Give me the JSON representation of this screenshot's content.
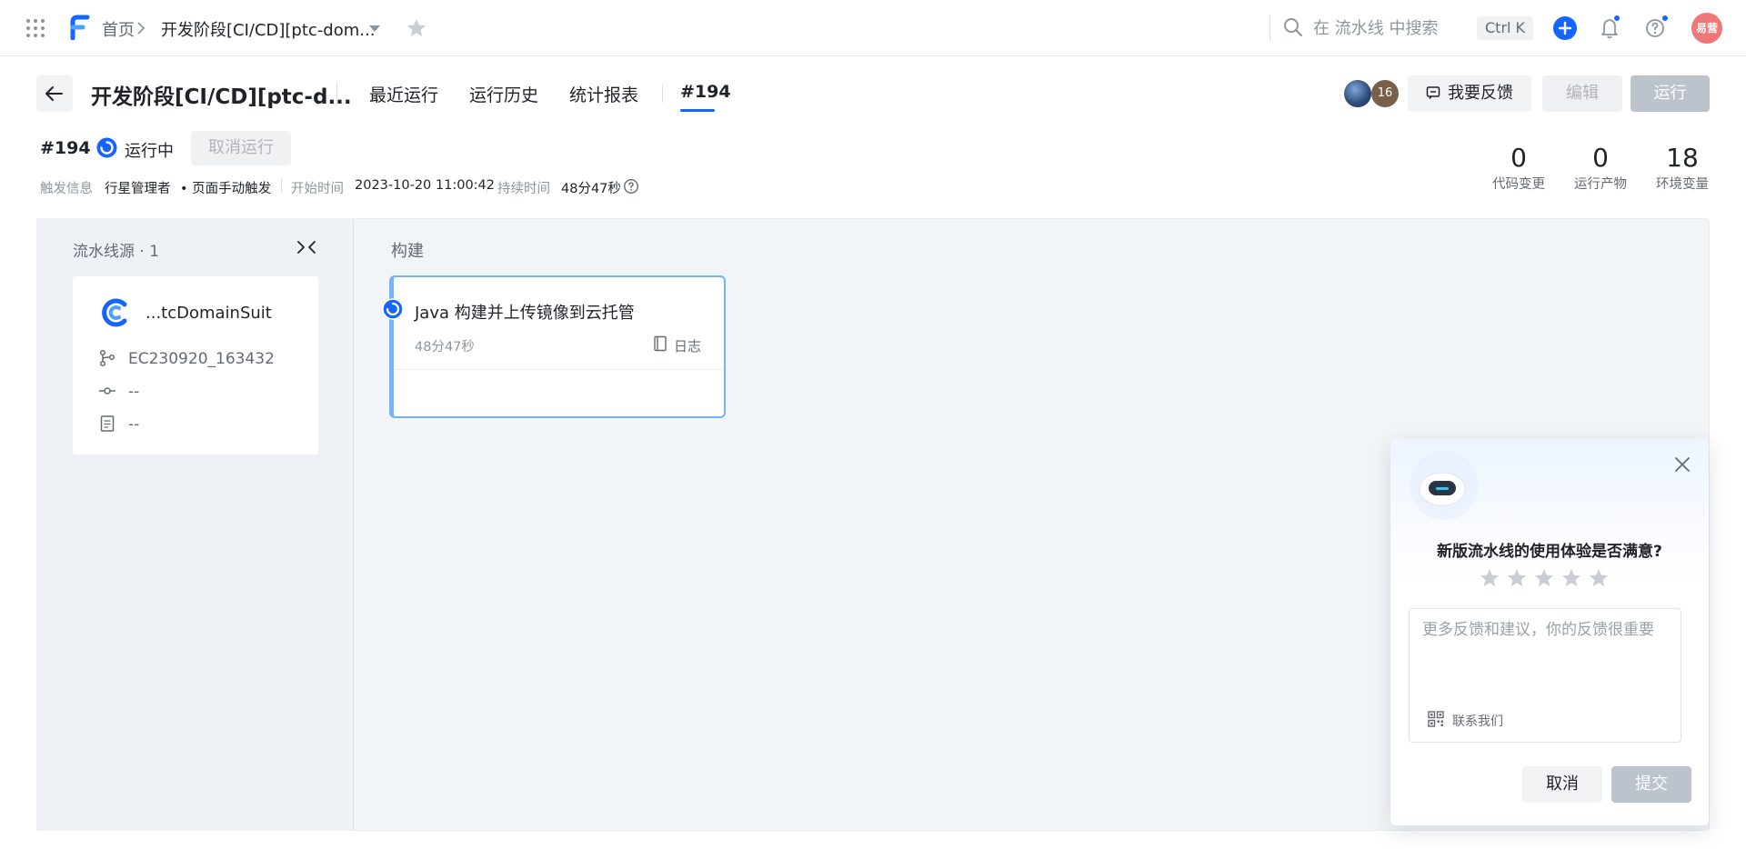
{
  "topbar": {
    "home": "首页",
    "current": "开发阶段[CI/CD][ptc-dom...",
    "search_placeholder": "在 流水线 中搜索",
    "shortcut": "Ctrl K",
    "avatar_text": "易营"
  },
  "header": {
    "title": "开发阶段[CI/CD][ptc-d...",
    "tabs": [
      {
        "label": "最近运行"
      },
      {
        "label": "运行历史"
      },
      {
        "label": "统计报表"
      },
      {
        "label": "#194",
        "active": true
      }
    ],
    "member_count": "16",
    "feedback_label": "我要反馈",
    "edit_label": "编辑",
    "run_label": "运行"
  },
  "run": {
    "number": "#194",
    "status": "运行中",
    "cancel_label": "取消运行",
    "trigger_label": "触发信息",
    "trigger_user": "行星管理者",
    "trigger_type": "• 页面手动触发",
    "start_label": "开始时间",
    "start_value": "2023-10-20 11:00:42",
    "duration_label": "持续时间",
    "duration_value": "48分47秒"
  },
  "stats": [
    {
      "value": "0",
      "label": "代码变更"
    },
    {
      "value": "0",
      "label": "运行产物"
    },
    {
      "value": "18",
      "label": "环境变量"
    }
  ],
  "source": {
    "title": "流水线源 · 1",
    "repo": "...tcDomainSuit",
    "branch": "EC230920_163432",
    "commit": "--",
    "message": "--"
  },
  "stage": {
    "title": "构建",
    "job_name": "Java 构建并上传镜像到云托管",
    "job_duration": "48分47秒",
    "log_label": "日志"
  },
  "feedback_popup": {
    "question": "新版流水线的使用体验是否满意?",
    "rating": 0,
    "max_rating": 5,
    "placeholder": "更多反馈和建议，你的反馈很重要",
    "contact_label": "联系我们",
    "cancel_label": "取消",
    "submit_label": "提交"
  },
  "colors": {
    "accent": "#1664ff",
    "running": "#1664ff",
    "job_border": "#74b3f5",
    "avatar": "#f07678",
    "disabled_button": "#bcc3cc"
  }
}
